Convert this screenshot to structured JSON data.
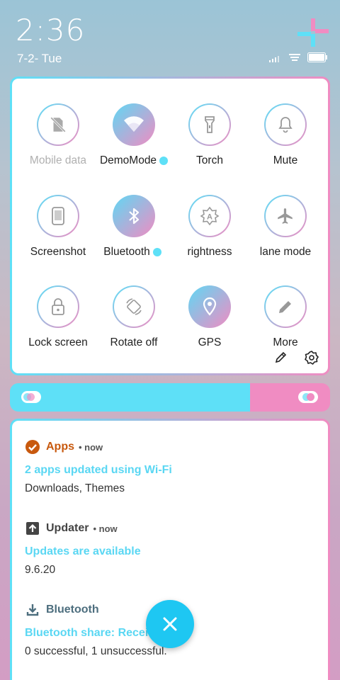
{
  "status": {
    "time": "2:36",
    "date": "7-2- Tue",
    "icons": [
      "signal-icon",
      "wifi-icon",
      "battery-icon"
    ]
  },
  "quick_settings": {
    "tiles": [
      {
        "label": "Mobile data",
        "icon": "sim-off-icon",
        "active": false,
        "muted": true
      },
      {
        "label": "DemoMode",
        "icon": "wifi-icon",
        "active": true,
        "dot": true
      },
      {
        "label": "Torch",
        "icon": "flashlight-icon",
        "active": false
      },
      {
        "label": "Mute",
        "icon": "bell-icon",
        "active": false
      },
      {
        "label": "Screenshot",
        "icon": "phone-icon",
        "active": false
      },
      {
        "label": "Bluetooth",
        "icon": "bluetooth-icon",
        "active": true,
        "dot": true
      },
      {
        "label": "rightness",
        "icon": "brightness-auto-icon",
        "active": false
      },
      {
        "label": "lane mode",
        "icon": "airplane-icon",
        "active": false
      },
      {
        "label": "Lock screen",
        "icon": "lock-icon",
        "active": false
      },
      {
        "label": "Rotate off",
        "icon": "rotate-icon",
        "active": false
      },
      {
        "label": "GPS",
        "icon": "location-icon",
        "active": true
      },
      {
        "label": "More",
        "icon": "pencil-icon",
        "active": false
      }
    ],
    "tools": [
      "edit-icon",
      "settings-icon"
    ]
  },
  "brightness": {
    "level": 0.75,
    "colors": {
      "left": "#5ee0f7",
      "right": "#f08cc2"
    }
  },
  "notifications": [
    {
      "app": "Apps",
      "time": "now",
      "title": "2 apps updated using Wi-Fi",
      "body": "Downloads, Themes",
      "app_color": "#c8590e",
      "icon": "check-badge-icon"
    },
    {
      "app": "Updater",
      "time": "now",
      "title": "Updates are available",
      "body": "9.6.20",
      "app_color": "#444444",
      "icon": "upload-icon"
    },
    {
      "app": "Bluetooth",
      "time": "",
      "title": "Bluetooth share: Receiv",
      "body": "0 successful, 1 unsuccessful.",
      "app_color": "#4d6e7e",
      "icon": "download-icon"
    }
  ],
  "fab": {
    "icon": "close-icon"
  },
  "colors": {
    "accent": "#5ee0f7",
    "pink": "#f08cc2",
    "fab": "#1ec7f2"
  }
}
